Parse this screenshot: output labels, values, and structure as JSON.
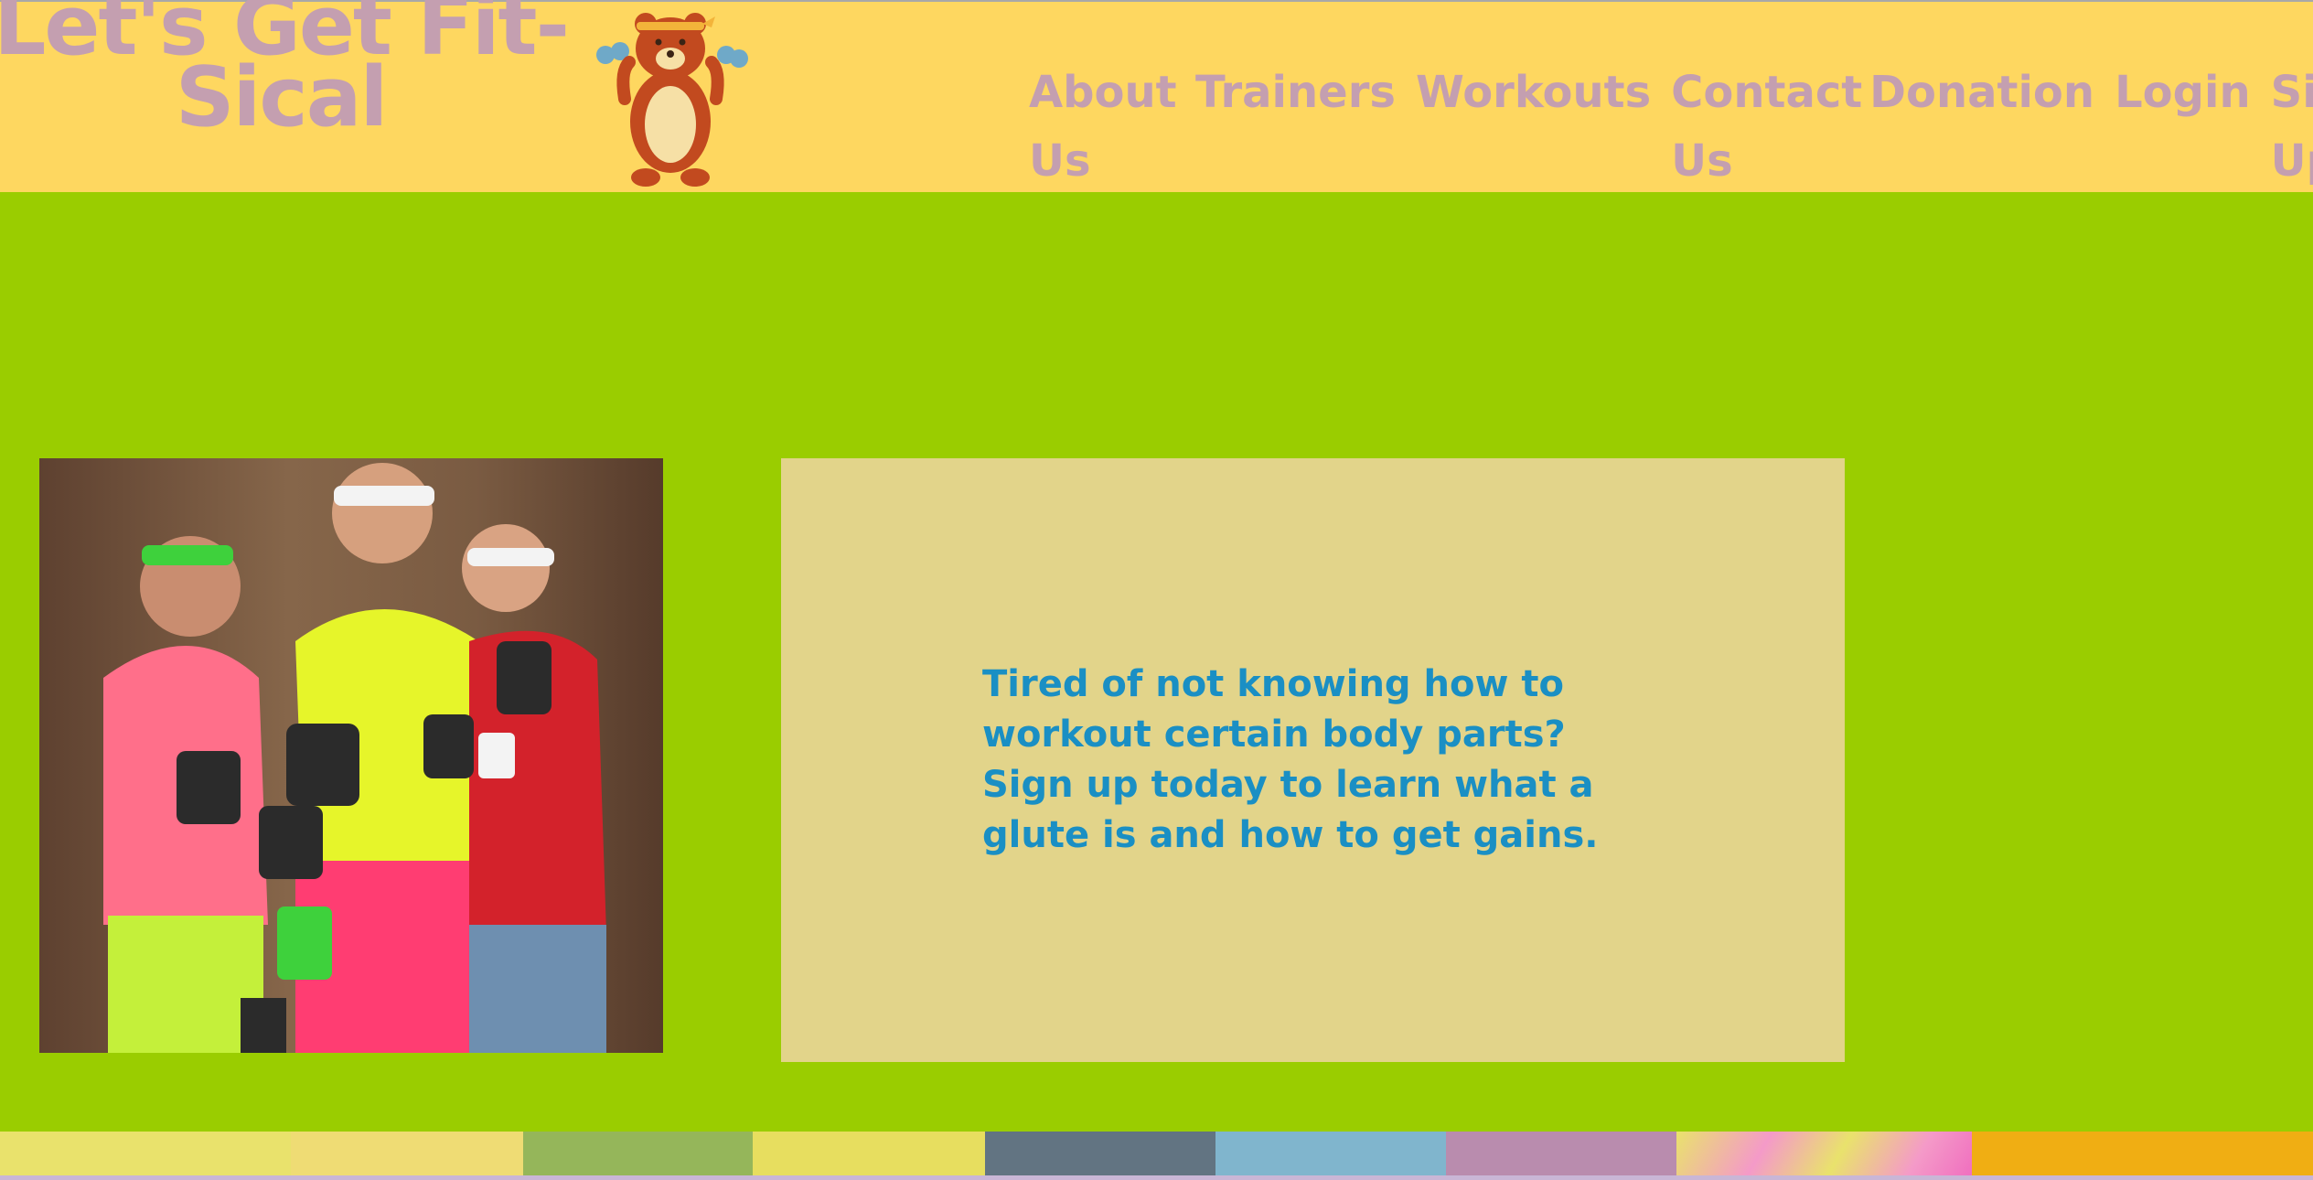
{
  "header": {
    "brand_line1": "Let's Get Fit-",
    "brand_line2": "Sical",
    "mascot_icon": "bear-with-dumbbells-icon",
    "nav": [
      {
        "line1": "About",
        "line2": "Us"
      },
      {
        "line1": "Trainers",
        "line2": ""
      },
      {
        "line1": "Workouts",
        "line2": ""
      },
      {
        "line1": "Contact",
        "line2": "Us"
      },
      {
        "line1": "Donation",
        "line2": ""
      },
      {
        "line1": "Login",
        "line2": ""
      },
      {
        "line1": "Sign",
        "line2": "Up"
      }
    ]
  },
  "main": {
    "photo_icon": "three-fitness-men-with-dumbbells-photo",
    "promo_text": "Tired of not knowing how to workout certain body parts? Sign up today to learn what a glute is and how to get gains."
  },
  "colors": {
    "header_bg": "#fed760",
    "page_bg": "#9acd00",
    "brand_text": "#c49fb0",
    "nav_text": "#c49fb0",
    "promo_bg": "#e2d48a",
    "promo_text": "#1a8fc4",
    "palette_strip": [
      "#e9e26c",
      "#efdc74",
      "#95b65a",
      "#e7de5f",
      "#627482",
      "#80b5cd",
      "#b98cae",
      "#e9c5c2",
      "#f0ae13"
    ]
  }
}
